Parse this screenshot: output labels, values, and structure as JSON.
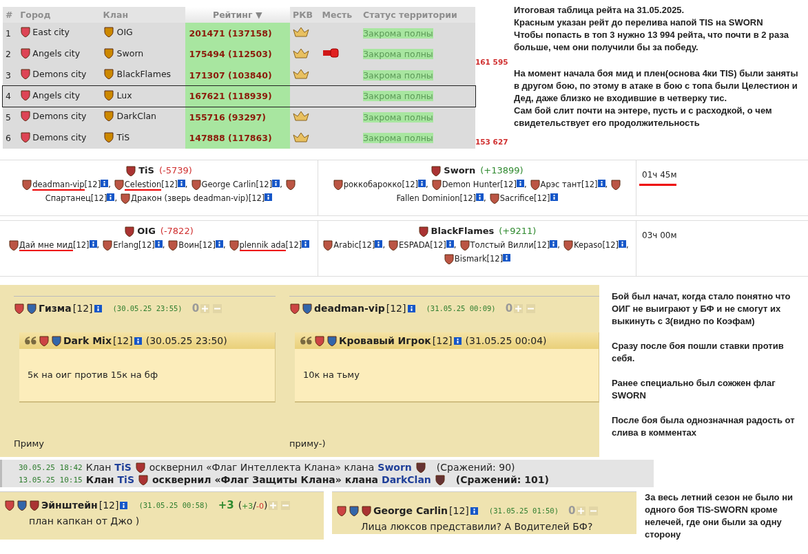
{
  "rating_table": {
    "columns": [
      {
        "label": "#",
        "sorted": false
      },
      {
        "label": "Город",
        "sorted": false
      },
      {
        "label": "Клан",
        "sorted": false
      },
      {
        "label": "Рейтинг ▼",
        "sorted": true
      },
      {
        "label": "РКВ",
        "sorted": false
      },
      {
        "label": "Месть",
        "sorted": false
      },
      {
        "label": "Статус территории",
        "sorted": false
      }
    ],
    "rows": [
      {
        "rank": "1",
        "city": "East city",
        "clan": "OIG",
        "rating": "201471 (137158)",
        "rkv": true,
        "revenge": false,
        "status": "Закрома полны",
        "highlighted": false
      },
      {
        "rank": "2",
        "city": "Angels city",
        "clan": "Sworn",
        "rating": "175494 (112503)",
        "rkv": true,
        "revenge": true,
        "status": "Закрома полны",
        "highlighted": false,
        "annotation": "161 595"
      },
      {
        "rank": "3",
        "city": "Demons city",
        "clan": "BlackFlames",
        "rating": "171307 (103840)",
        "rkv": true,
        "revenge": false,
        "status": "Закрома полны",
        "highlighted": false
      },
      {
        "rank": "4",
        "city": "Angels city",
        "clan": "Lux",
        "rating": "167621 (118939)",
        "rkv": false,
        "revenge": false,
        "status": "Закрома полны",
        "highlighted": true
      },
      {
        "rank": "5",
        "city": "Demons city",
        "clan": "DarkClan",
        "rating": "155716 (93297)",
        "rkv": true,
        "revenge": false,
        "status": "Закрома полны",
        "highlighted": false
      },
      {
        "rank": "6",
        "city": "Demons city",
        "clan": "TiS",
        "rating": "147888 (117863)",
        "rkv": true,
        "revenge": false,
        "status": "Закрома полны",
        "highlighted": false,
        "annotation": "153 627"
      }
    ]
  },
  "top_notes": [
    [
      "Итоговая таблица рейта на 31.05.2025.",
      "Красным указан рейт до перелива напой TIS на SWORN",
      "Чтобы попасть в топ 3 нужно 13 994 рейта, что почти в 2 раза больше, чем они получили бы за победу."
    ],
    [
      "На момент начала боя мид и плен(основа 4ки TIS) были заняты в другом бою, по этому в атаке в бою с топа были Целестион и Дед, даже близко не входившие в четверку тис.",
      "Сам бой слит почти на энтере, пусть и с расходкой, о чем свидетельствует его продолжительность"
    ]
  ],
  "battles": [
    {
      "left": {
        "clan": "TiS",
        "delta": "(-5739)",
        "color": "#d03030",
        "members": [
          {
            "name": "deadman-vip",
            "level": "[12]",
            "separator": ",",
            "underlined": true
          },
          {
            "name": "Celestion",
            "level": "[12]",
            "separator": ",",
            "underlined": true
          },
          {
            "name": "George Carlin",
            "level": "[12]",
            "separator": ",",
            "underlined": false
          },
          {
            "name": "Спартанец",
            "level": "[12]",
            "separator": ",",
            "underlined": false
          },
          {
            "name": "Дракон (зверь deadman-vip)",
            "level": "[12]",
            "underlined": false
          }
        ]
      },
      "right": {
        "clan": "Sworn",
        "delta": "(+13899)",
        "color": "#2f8a2f",
        "members": [
          {
            "name": "роккобарокко",
            "level": "[12]",
            "separator": ",",
            "underlined": false
          },
          {
            "name": "Demon Hunter",
            "level": "[12]",
            "separator": ",",
            "underlined": false
          },
          {
            "name": "Арэс тант",
            "level": "[12]",
            "separator": ",",
            "underlined": false
          },
          {
            "name": "Fallen Dominion",
            "level": "[12]",
            "separator": ",",
            "underlined": false
          },
          {
            "name": "Sacrifice",
            "level": "[12]",
            "underlined": false
          }
        ]
      },
      "duration": "01ч 45м",
      "duration_underlined": true
    },
    {
      "left": {
        "clan": "OIG",
        "delta": "(-7822)",
        "color": "#d03030",
        "members": [
          {
            "name": "Дай мне мид",
            "level": "[12]",
            "separator": ",",
            "underlined": true
          },
          {
            "name": "Erlang",
            "level": "[12]",
            "separator": ",",
            "underlined": false
          },
          {
            "name": "Воин",
            "level": "[12]",
            "separator": ",",
            "underlined": false
          },
          {
            "name": "plennik ada",
            "level": "[12]",
            "underlined": true
          }
        ]
      },
      "right": {
        "clan": "BlackFlames",
        "delta": "(+9211)",
        "color": "#2f8a2f",
        "members": [
          {
            "name": "Arabic",
            "level": "[12]",
            "separator": ",",
            "underlined": false
          },
          {
            "name": "ESPADA",
            "level": "[12]",
            "separator": ",",
            "underlined": false
          },
          {
            "name": "Толстый Вилли",
            "level": "[12]",
            "separator": ",",
            "underlined": false
          },
          {
            "name": "Kepaso",
            "level": "[12]",
            "separator": ",",
            "underlined": false
          },
          {
            "name": "Bismark",
            "level": "[12]",
            "underlined": false
          }
        ]
      },
      "duration": "03ч 00м",
      "duration_underlined": false
    }
  ],
  "comments": [
    {
      "author": "Гизма",
      "level": "[12]",
      "date": "(30.05.25 23:55)",
      "score": "0",
      "quote": {
        "author": "Dark Mix",
        "level": "[12]",
        "date": "(30.05.25 23:50)",
        "text": "5к на оиг против 15к на бф"
      },
      "reply": "Приму"
    },
    {
      "author": "deadman-vip",
      "level": "[12]",
      "date": "(31.05.25 00:09)",
      "score": "0",
      "quote": {
        "author": "Кровавый Игрок",
        "level": "[12]",
        "date": "(31.05.25 00:04)",
        "text": "10к на тьму"
      },
      "reply": "приму-)"
    }
  ],
  "middle_notes": [
    "Бой был начат, когда стало понятно что ОИГ не выиграют у БФ и не смогут их выкинуть с 3(видно по Коэфам)",
    "Сразу после боя пошли ставки против себя.",
    "Ранее специально был сожжен флаг SWORN",
    "После боя была однозначная радость от слива в комментах"
  ],
  "event_log": [
    {
      "date": "30.05.25 18:42",
      "prefix": "Клан",
      "clan": "TiS",
      "action": "осквернил «Флаг Интеллекта Клана» клана",
      "target": "Sworn",
      "battles": "(Сражений: 90)",
      "bold": false
    },
    {
      "date": "13.05.25 10:15",
      "prefix": "Клан",
      "clan": "TiS",
      "action": "осквернил «Флаг Защиты Клана» клана",
      "target": "DarkClan",
      "battles": "(Сражений: 101)",
      "bold": true
    }
  ],
  "bottom_comments": [
    {
      "author": "Эйнштейн",
      "level": "[12]",
      "date": "(31.05.25 00:58)",
      "score": "+3",
      "color": "#2f8a2f",
      "votes": [
        {
          "text": "(",
          "kind": "plain"
        },
        {
          "text": "+3",
          "kind": "up"
        },
        {
          "text": "/",
          "kind": "plain"
        },
        {
          "text": "-0",
          "kind": "down"
        },
        {
          "text": ")",
          "kind": "plain"
        }
      ],
      "text": "план капкан от Джо )"
    },
    {
      "author": "George Carlin",
      "level": "[12]",
      "date": "(31.05.25 01:50)",
      "score": "0",
      "color": "#999999",
      "text": "Лица люксов представили? А Водителей БФ?"
    }
  ],
  "bottom_note": "За весь летний сезон не было ни одного боя TIS-SWORN кроме нелечей, где они были за одну сторону"
}
